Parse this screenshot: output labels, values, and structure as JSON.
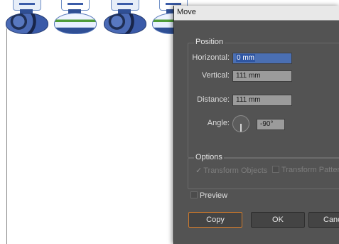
{
  "dialog": {
    "title": "Move",
    "position": {
      "legend": "Position",
      "horizontal_label": "Horizontal:",
      "horizontal_value": "0 mm",
      "vertical_label": "Vertical:",
      "vertical_value": "111 mm",
      "distance_label": "Distance:",
      "distance_value": "111 mm",
      "angle_label": "Angle:",
      "angle_value": "-90°"
    },
    "options": {
      "legend": "Options",
      "transform_objects": "Transform Objects",
      "transform_objects_checked": true,
      "transform_patterns": "Transform Patterns",
      "transform_patterns_checked": false
    },
    "preview": {
      "label": "Preview",
      "checked": false
    },
    "buttons": {
      "copy": "Copy",
      "ok": "OK",
      "cancel": "Cancel"
    }
  },
  "colors": {
    "dialog_bg": "#535353",
    "focus_outline": "#d07a2b",
    "selection": "#4a6fb3"
  }
}
